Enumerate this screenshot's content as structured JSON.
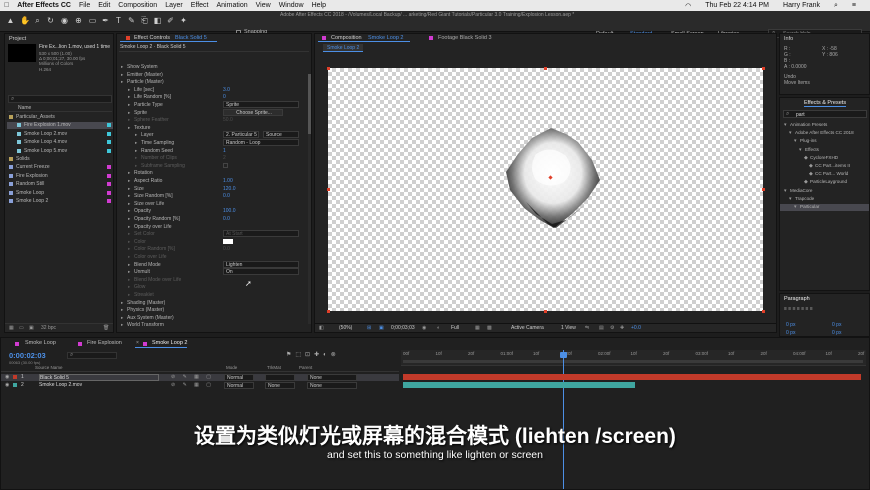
{
  "menubar": {
    "app": "After Effects CC",
    "items": [
      "File",
      "Edit",
      "Composition",
      "Layer",
      "Effect",
      "Animation",
      "View",
      "Window",
      "Help"
    ],
    "clock": "Thu Feb 22  4:14 PM",
    "user": "Harry Frank"
  },
  "window_title": "Adobe After Effects CC 2018 - /Volumes/Local Backup/ ... arketing/Red Giant Tutorials/Particular 3.0 Training/Explosion Lesson.aep *",
  "toolbar": {
    "snapping": "Snapping",
    "workspaces": [
      "Default",
      "Standard",
      "Small Screen",
      "Libraries"
    ],
    "active_workspace": "Standard",
    "search_help": "Search Help"
  },
  "project": {
    "tab": "Project",
    "footage_name": "Fire Ex...lion 1.mov",
    "used": ", used 1 time",
    "info": [
      "530 x 500 (1.00)",
      "Δ 0;00;01;27, 30.00 fps",
      "Millions of Colors",
      "H.264"
    ],
    "column": "Name",
    "items": [
      {
        "name": "Particular_Assets",
        "type": "folder"
      },
      {
        "name": "Fire Explosion 1.mov",
        "type": "footage",
        "selected": true
      },
      {
        "name": "Smoke Loop 2.mov",
        "type": "footage"
      },
      {
        "name": "Smoke Loop 4.mov",
        "type": "footage"
      },
      {
        "name": "Smoke Loop 5.mov",
        "type": "footage"
      },
      {
        "name": "Solids",
        "type": "folder"
      },
      {
        "name": "Current Freeze",
        "type": "comp"
      },
      {
        "name": "Fire Explosion",
        "type": "comp"
      },
      {
        "name": "Random Still",
        "type": "comp"
      },
      {
        "name": "Smoke Loop",
        "type": "comp"
      },
      {
        "name": "Smoke Loop 2",
        "type": "comp"
      }
    ],
    "bpc": "32 bpc"
  },
  "effect_controls": {
    "tab_prefix": "Effect Controls",
    "tab_layer": "Black Solid 5",
    "path": "Smoke Loop 2 · Black Solid 5",
    "rows": [
      {
        "label": "Show System",
        "indent": 0
      },
      {
        "label": "Emitter (Master)",
        "indent": 0
      },
      {
        "label": "Particle (Master)",
        "indent": 0
      },
      {
        "label": "Life [sec]",
        "indent": 1,
        "value": "3.0"
      },
      {
        "label": "Life Random [%]",
        "indent": 1,
        "value": "0"
      },
      {
        "label": "Particle Type",
        "indent": 1,
        "select": "Sprite"
      },
      {
        "label": "Sprite",
        "indent": 1,
        "button": "Choose Sprite..."
      },
      {
        "label": "Sphere Feather",
        "indent": 1,
        "value": "50.0",
        "dim": true
      },
      {
        "label": "Texture",
        "indent": 1
      },
      {
        "label": "Layer",
        "indent": 2,
        "select": "2. Particular 5",
        "select2": "Source"
      },
      {
        "label": "Time Sampling",
        "indent": 2,
        "select": "Random - Loop"
      },
      {
        "label": "Random Seed",
        "indent": 2,
        "value": "1"
      },
      {
        "label": "Number of Clips",
        "indent": 2,
        "value": "2",
        "dim": true
      },
      {
        "label": "Subframe Sampling",
        "indent": 2,
        "dim": true
      },
      {
        "label": "Rotation",
        "indent": 1
      },
      {
        "label": "Aspect Ratio",
        "indent": 1,
        "value": "1.00"
      },
      {
        "label": "Size",
        "indent": 1,
        "value": "120.0"
      },
      {
        "label": "Size Random [%]",
        "indent": 1,
        "value": "0.0"
      },
      {
        "label": "Size over Life",
        "indent": 1
      },
      {
        "label": "Opacity",
        "indent": 1,
        "value": "100.0"
      },
      {
        "label": "Opacity Random [%]",
        "indent": 1,
        "value": "0.0"
      },
      {
        "label": "Opacity over Life",
        "indent": 1
      },
      {
        "label": "Set Color",
        "indent": 1,
        "select": "At Start",
        "dim": true
      },
      {
        "label": "Color",
        "indent": 1,
        "dim": true
      },
      {
        "label": "Color Random [%]",
        "indent": 1,
        "value": "0.0",
        "dim": true
      },
      {
        "label": "Color over Life",
        "indent": 1,
        "dim": true
      },
      {
        "label": "Blend Mode",
        "indent": 1,
        "select": "Lighten"
      },
      {
        "label": "Unmult",
        "indent": 1,
        "select": "On"
      },
      {
        "label": "Blend Mode over Life",
        "indent": 1,
        "dim": true
      },
      {
        "label": "Glow",
        "indent": 1,
        "dim": true
      },
      {
        "label": "Streaklet",
        "indent": 1,
        "dim": true
      },
      {
        "label": "Shading (Master)",
        "indent": 0
      },
      {
        "label": "Physics (Master)",
        "indent": 0
      },
      {
        "label": "Aux System (Master)",
        "indent": 0
      },
      {
        "label": "World Transform",
        "indent": 0
      }
    ]
  },
  "composition": {
    "tab_prefix": "Composition",
    "tab_name": "Smoke Loop 2",
    "footage_tab": "Footage Black Solid 3",
    "sub_tab": "Smoke Loop 2",
    "zoom": "(50%)",
    "timecode": "0;00;03;03",
    "resolution": "Full",
    "camera": "Active Camera",
    "views": "1 View",
    "exposure": "+0.0"
  },
  "info": {
    "tab": "Info",
    "rgb": [
      "R :",
      "G :",
      "B :",
      "A : 0.0000"
    ],
    "xy": [
      "X : -58",
      "Y : 806"
    ],
    "undo": "Undo",
    "undo_item": "Move Items"
  },
  "effects_presets": {
    "tab": "Effects & Presets",
    "search": "part",
    "tree": [
      {
        "label": "Animation Presets",
        "indent": 0
      },
      {
        "label": "Adobe After Effects CC 2018",
        "indent": 1
      },
      {
        "label": "Plug-ins",
        "indent": 2
      },
      {
        "label": "Effects",
        "indent": 3
      },
      {
        "label": "CycloreFXHD",
        "indent": 4
      },
      {
        "label": "CC Part...items II",
        "indent": 5
      },
      {
        "label": "CC Part... World",
        "indent": 5
      },
      {
        "label": "ParticleLayground",
        "indent": 4
      },
      {
        "label": "MediaCore",
        "indent": 0
      },
      {
        "label": "Trapcode",
        "indent": 1
      },
      {
        "label": "Particular",
        "indent": 2,
        "selected": true
      }
    ]
  },
  "paragraph": {
    "tab": "Paragraph",
    "values": [
      "0 px",
      "0 px",
      "0 px",
      "0 px",
      "0 px"
    ]
  },
  "timeline": {
    "tabs": [
      {
        "label": "Smoke Loop",
        "color": "#d13bd1"
      },
      {
        "label": "Fire Explosion",
        "color": "#d13bd1"
      },
      {
        "label": "Smoke Loop 2",
        "color": "#d13bd1",
        "active": true
      }
    ],
    "timecode": "0:00:02:03",
    "frames": "00063 (30.00 fps)",
    "columns": {
      "source": "Source Name",
      "mode": "Mode",
      "trkmat": "TrkMat",
      "parent": "Parent"
    },
    "layers": [
      {
        "num": "1",
        "name": "Black Solid 5",
        "mode": "Normal",
        "trkmat": "",
        "parent": "None",
        "color": "#c23a2a"
      },
      {
        "num": "2",
        "name": "Smoke Loop 2.mov",
        "mode": "Normal",
        "trkmat": "None",
        "parent": "None",
        "color": "#3fa6a0"
      }
    ],
    "ruler": [
      "00f",
      "10f",
      "20f",
      "01:00f",
      "10f",
      "20f",
      "02:00f",
      "10f",
      "20f",
      "03:00f",
      "10f",
      "20f",
      "04:00f",
      "10f",
      "20f"
    ]
  },
  "subtitles": {
    "cn": "设置为类似灯光或屏幕的混合模式 (liehten /screen)",
    "en": "and set this to something like lighten or screen"
  },
  "colors": {
    "accent_blue": "#4c8fe6",
    "label_magenta": "#d13bd1",
    "layer_red": "#c23a2a",
    "layer_teal": "#3fa6a0"
  }
}
